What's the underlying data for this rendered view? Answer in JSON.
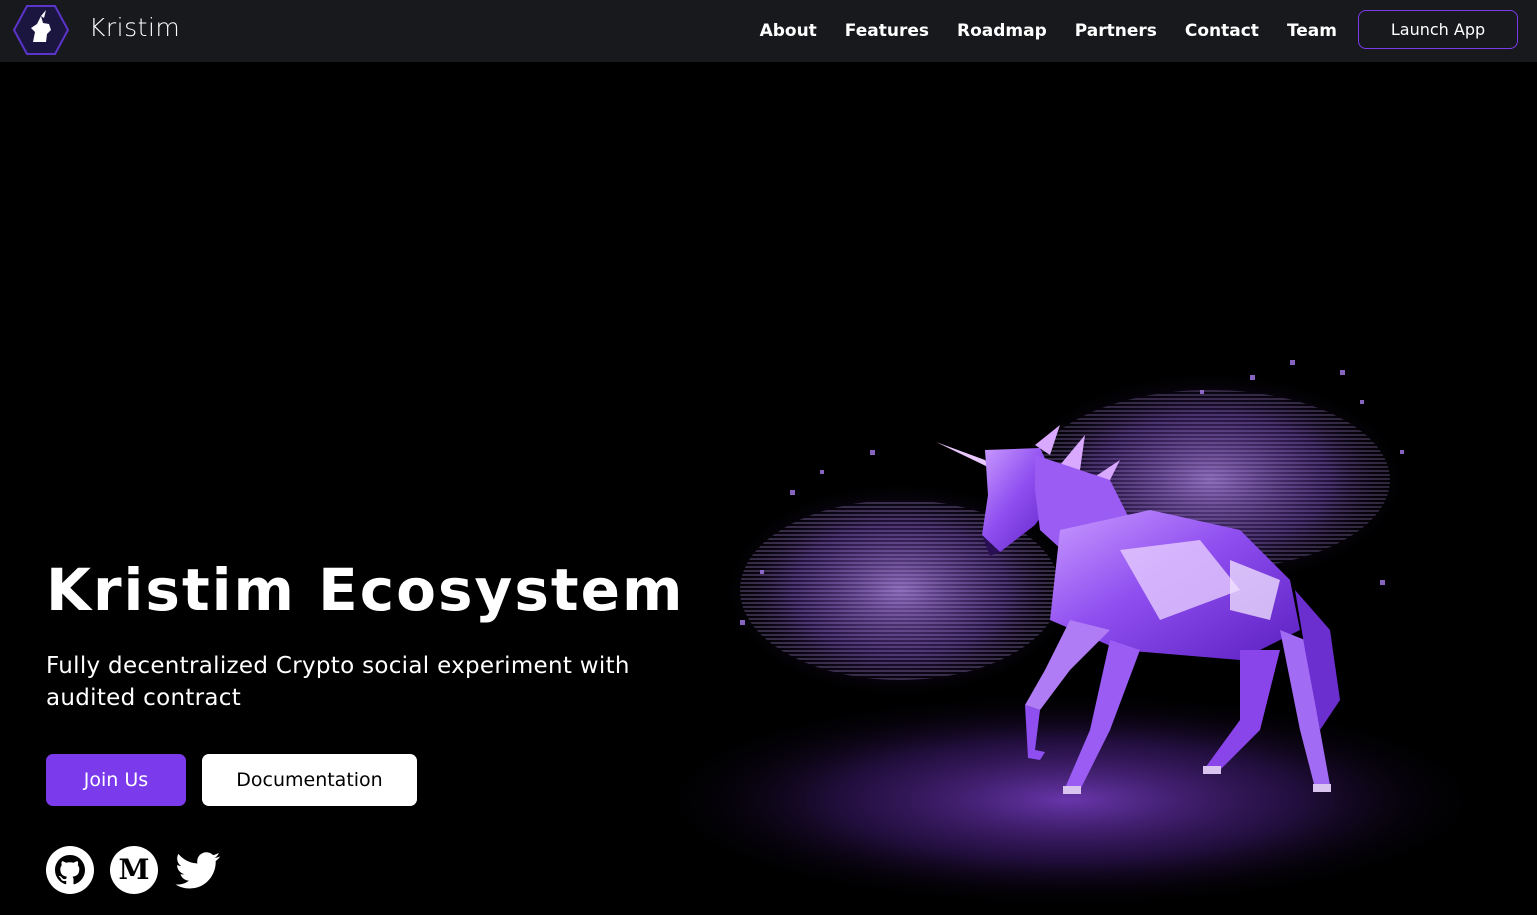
{
  "header": {
    "brand": "Kristim",
    "nav": [
      "About",
      "Features",
      "Roadmap",
      "Partners",
      "Contact",
      "Team"
    ],
    "cta": "Launch App"
  },
  "hero": {
    "title": "Kristim Ecosystem",
    "subtitle": "Fully decentralized Crypto social experiment with audited contract",
    "primary_button": "Join Us",
    "secondary_button": "Documentation",
    "social_icons": [
      "github-icon",
      "medium-icon",
      "twitter-icon"
    ]
  },
  "colors": {
    "accent": "#7c3aed",
    "navbar_bg": "#18191d",
    "page_bg": "#000000"
  }
}
